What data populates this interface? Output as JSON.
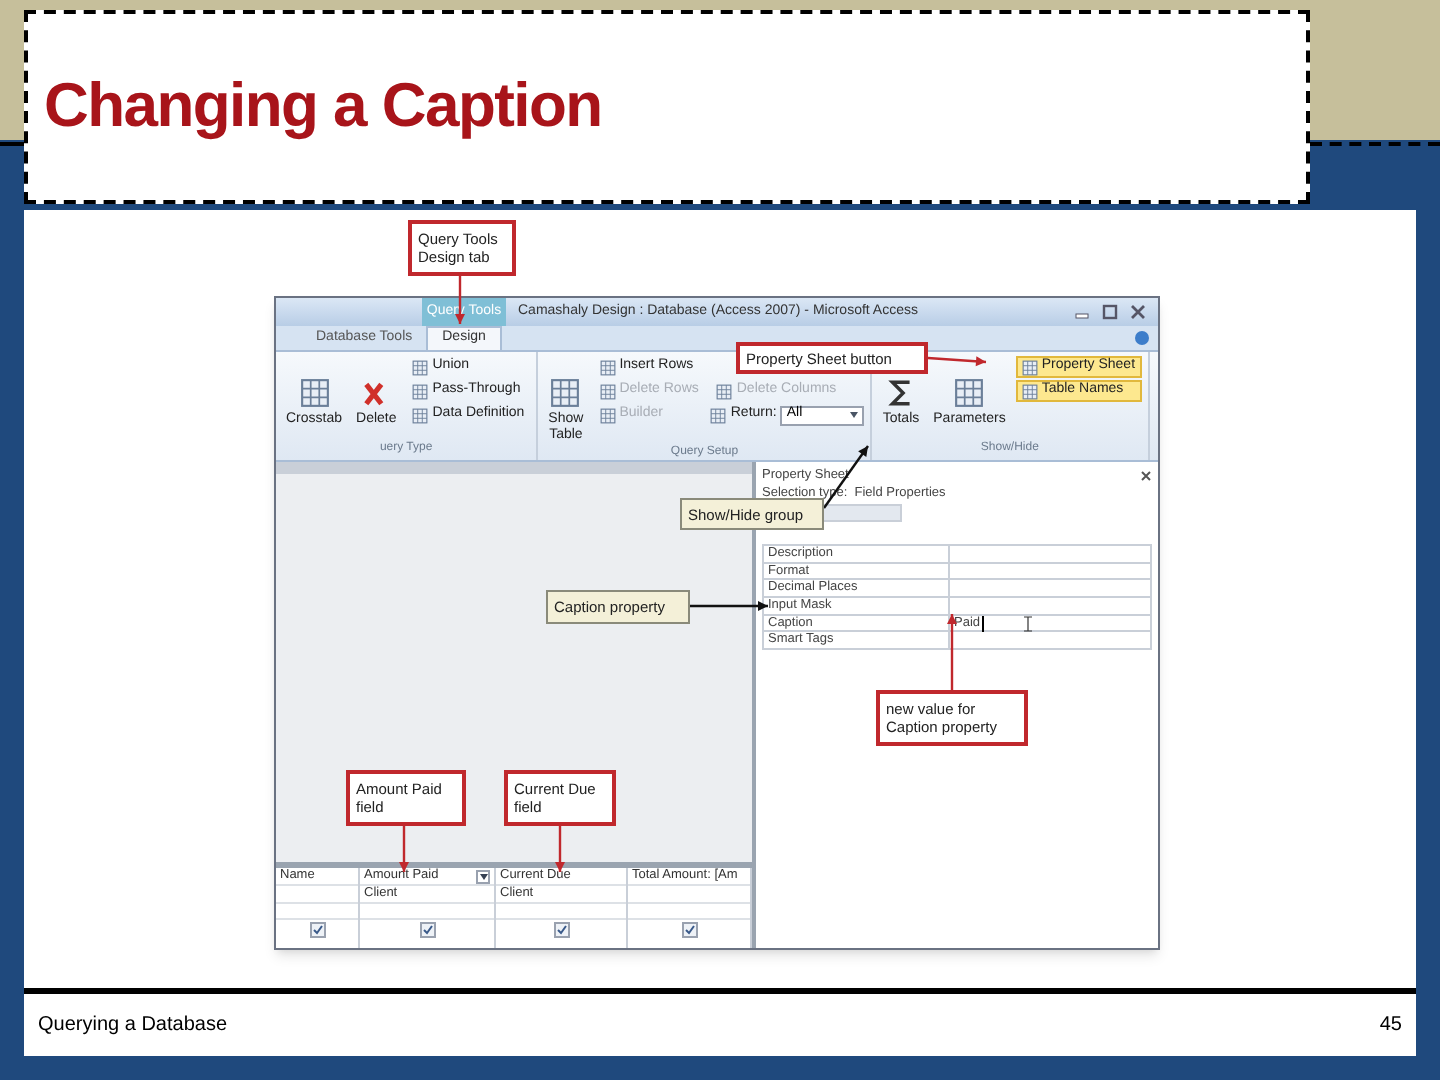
{
  "slide": {
    "title": "Changing a Caption",
    "footer": "Querying a Database",
    "page_number": "45"
  },
  "window": {
    "contextual_tab": "Query Tools",
    "title": "Camashaly Design : Database (Access 2007) - Microsoft Access"
  },
  "tabs": [
    {
      "label": "Database Tools",
      "selected": false
    },
    {
      "label": "Design",
      "selected": true
    }
  ],
  "ribbon_groups": [
    {
      "label": "uery Type",
      "columns": [
        {
          "kind": "large",
          "label": "Crosstab"
        },
        {
          "kind": "large",
          "label": "Delete"
        },
        {
          "kind": "stack",
          "items": [
            {
              "kind": "button",
              "label": "Union",
              "disabled": false,
              "highlighted": false
            },
            {
              "kind": "button",
              "label": "Pass-Through",
              "disabled": false,
              "highlighted": false
            },
            {
              "kind": "button",
              "label": "Data Definition",
              "disabled": false,
              "highlighted": false
            }
          ]
        }
      ]
    },
    {
      "label": "Query Setup",
      "columns": [
        {
          "kind": "large",
          "label": "Show Table"
        },
        {
          "kind": "stack",
          "items": [
            {
              "kind": "button",
              "label": "Insert Rows",
              "disabled": false,
              "highlighted": false
            },
            {
              "kind": "button",
              "label": "Delete Rows",
              "disabled": true,
              "highlighted": false
            },
            {
              "kind": "button",
              "label": "Builder",
              "disabled": true,
              "highlighted": false
            }
          ]
        },
        {
          "kind": "stack",
          "items": [
            {
              "kind": "button",
              "label": "Delete Columns",
              "disabled": true,
              "highlighted": false
            },
            {
              "kind": "combo",
              "label": "Return:",
              "value": "All",
              "disabled": false,
              "highlighted": false
            }
          ]
        }
      ]
    },
    {
      "label": "Show/Hide",
      "columns": [
        {
          "kind": "large",
          "label": "Totals"
        },
        {
          "kind": "large",
          "label": "Parameters"
        },
        {
          "kind": "stack",
          "items": [
            {
              "kind": "button",
              "label": "Property Sheet",
              "disabled": false,
              "highlighted": true
            },
            {
              "kind": "button",
              "label": "Table Names",
              "disabled": false,
              "highlighted": true
            }
          ]
        }
      ]
    }
  ],
  "property_sheet": {
    "title": "Property Sheet",
    "selection_type": "Selection type:  Field Properties",
    "rows": [
      {
        "name": "Description"
      },
      {
        "name": "Format"
      },
      {
        "name": "Decimal Places"
      },
      {
        "name": "Input Mask"
      },
      {
        "name": "Caption",
        "value": "Paid"
      },
      {
        "name": "Smart Tags"
      }
    ]
  },
  "query_grid": {
    "columns": [
      {
        "field": "Name",
        "show": true,
        "dropdown": false
      },
      {
        "field": "Amount Paid",
        "table": "Client",
        "show": true,
        "dropdown": true
      },
      {
        "field": "Current Due",
        "table": "Client",
        "show": true,
        "dropdown": false
      },
      {
        "field": "Total Amount: [Am",
        "show": true,
        "dropdown": false
      }
    ]
  },
  "callouts": [
    {
      "text": "Query Tools Design tab",
      "kind": "highlight"
    },
    {
      "text": "Property Sheet button",
      "kind": "highlight"
    },
    {
      "text": "Show/Hide group",
      "kind": "note"
    },
    {
      "text": "Caption property",
      "kind": "note"
    },
    {
      "text": "new value for Caption property",
      "kind": "highlight"
    },
    {
      "text": "Amount Paid field",
      "kind": "highlight"
    },
    {
      "text": "Current Due field",
      "kind": "highlight"
    }
  ]
}
